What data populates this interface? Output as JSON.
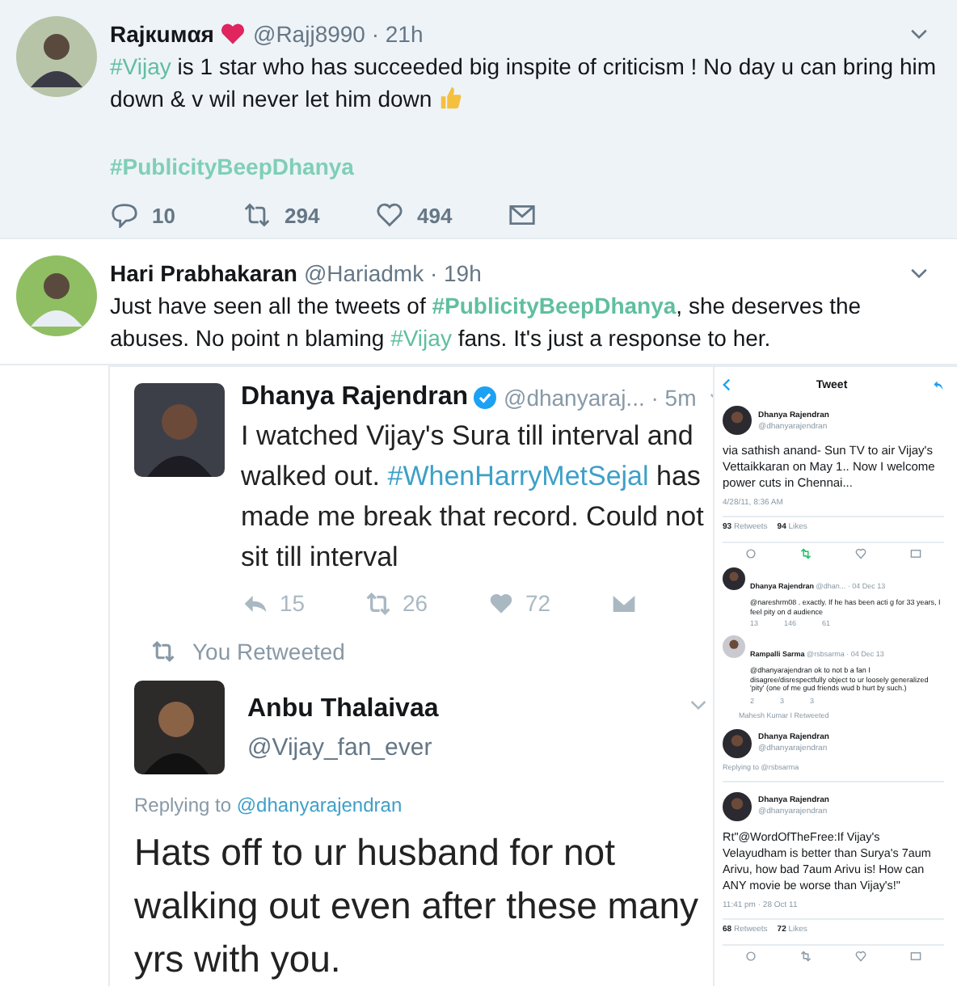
{
  "tweets": [
    {
      "name": "Rajкuмαя",
      "heart": true,
      "handle_time": "@Rajj8990 · 21h",
      "shaded": true,
      "text": [
        {
          "kind": "hashtag",
          "text": "#Vijay"
        },
        {
          "kind": "plain",
          "text": " is 1 star who has succeeded big inspite of criticism ! No day u can bring him down & v wil never let him down "
        },
        {
          "kind": "thumbs"
        }
      ],
      "footer_hashtag": "#PublicityBeepDhanya",
      "actions": [
        {
          "kind": "reply",
          "count": "10"
        },
        {
          "kind": "retweet",
          "count": "294"
        },
        {
          "kind": "like",
          "count": "494"
        },
        {
          "kind": "message"
        }
      ]
    },
    {
      "name": "Hari Prabhakaran",
      "heart": false,
      "handle_time": "@Hariadmk · 19h",
      "shaded": false,
      "text": [
        {
          "kind": "plain",
          "text": "Just have seen all the tweets of "
        },
        {
          "kind": "hashtag-bold",
          "text": "#PublicityBeepDhanya"
        },
        {
          "kind": "plain",
          "text": ", she deserves the abuses. No point n blaming "
        },
        {
          "kind": "hashtag",
          "text": "#Vijay"
        },
        {
          "kind": "plain",
          "text": " fans. It's just a response to her."
        }
      ]
    }
  ],
  "left_screenshot": {
    "quoted": {
      "name": "Dhanya Rajendran",
      "verified": true,
      "handle_time": "@dhanyaraj... · 5m",
      "text": [
        {
          "kind": "plain",
          "text": "I watched Vijay's Sura till interval and walked out. "
        },
        {
          "kind": "hashtag",
          "text": "#WhenHarryMetSejal"
        },
        {
          "kind": "plain",
          "text": " has made me break that record. Could not sit till interval"
        }
      ],
      "actions": [
        {
          "kind": "reply",
          "count": "15"
        },
        {
          "kind": "retweet",
          "count": "26"
        },
        {
          "kind": "like",
          "count": "72"
        },
        {
          "kind": "message"
        }
      ]
    },
    "retweet_label": "You Retweeted",
    "reply": {
      "name": "Anbu Thalaivaa",
      "handle": "@Vijay_fan_ever",
      "replying_prefix": "Replying to ",
      "replying_to": "@dhanyarajendran",
      "text": "Hats off to ur husband for not walking out even after these many yrs with you."
    }
  },
  "right_screenshot": {
    "header_title": "Tweet",
    "main": {
      "name": "Dhanya Rajendran",
      "handle": "@dhanyarajendran",
      "text": "via sathish anand- Sun TV to air Vijay's Vettaikkaran on May 1.. Now I welcome power cuts in Chennai...",
      "date": "4/28/11, 8:36 AM",
      "stats": [
        {
          "count": "93",
          "label": "Retweets"
        },
        {
          "count": "94",
          "label": "Likes"
        }
      ]
    },
    "replies": [
      {
        "name": "Dhanya Rajendran",
        "handle_time": "@dhan... · 04 Dec 13",
        "text": "@nareshrm08 . exactly. If he has been acti g for 33 years, I feel pity on d audience",
        "counts": [
          "13",
          "146",
          "61"
        ]
      },
      {
        "name": "Rampalli Sarma",
        "handle_time": "@rsbsarma · 04 Dec 13",
        "text": "@dhanyarajendran ok to not b a fan I disagree/disrespectfully object to ur loosely generalized 'pity' (one of me gud friends wud b hurt by such.)",
        "counts": [
          "2",
          "3",
          "3"
        ]
      }
    ],
    "retweeted_by": "Mahesh Kumar I Retweeted",
    "thread": {
      "name": "Dhanya Rajendran",
      "handle": "@dhanyarajendran",
      "replying": "Replying to @rsbsarma"
    },
    "card": {
      "name": "Dhanya Rajendran",
      "handle": "@dhanyarajendran",
      "text": "Rt\"@WordOfTheFree:If Vijay's Velayudham is better than Surya's 7aum Arivu, how bad 7aum Arivu is! How can ANY movie be worse than Vijay's!\"",
      "date": "11:41 pm · 28 Oct 11",
      "stats": [
        {
          "count": "68",
          "label": "Retweets"
        },
        {
          "count": "72",
          "label": "Likes"
        }
      ]
    }
  }
}
